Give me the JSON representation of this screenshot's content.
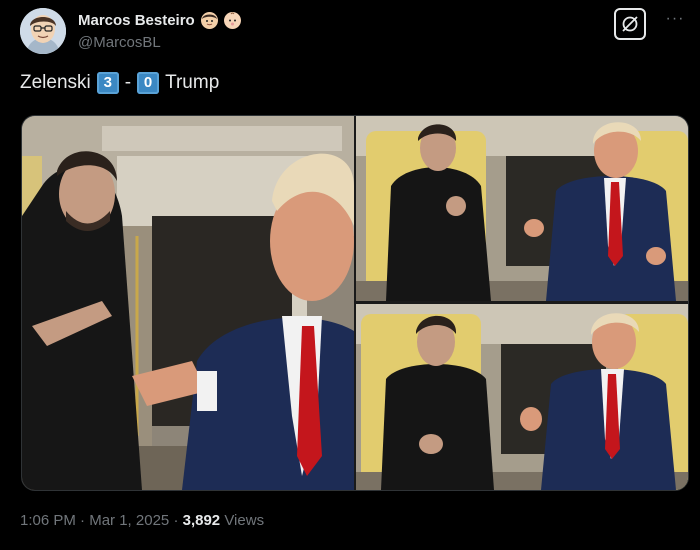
{
  "author": {
    "display_name": "Marcos Besteiro",
    "handle": "@MarcosBL",
    "avatar_icon": "cartoon-avatar-icon",
    "badges": [
      "face-emoji-icon",
      "baby-face-emoji-icon"
    ]
  },
  "actions": {
    "grok_icon": "grok-icon",
    "more_icon": "more-options-icon",
    "more_label": "···"
  },
  "tweet": {
    "text_left": "Zelenski",
    "score_left": "3",
    "separator": "-",
    "score_right": "0",
    "text_right": "Trump"
  },
  "media": {
    "count": 3,
    "photos": [
      "photo-main",
      "photo-top-right",
      "photo-bottom-right"
    ]
  },
  "meta": {
    "time": "1:06 PM",
    "dot1": "·",
    "date": "Mar 1, 2025",
    "dot2": "·",
    "views_count": "3,892",
    "views_label": "Views"
  },
  "colors": {
    "background": "#000000",
    "text": "#e7e9ea",
    "secondary": "#71767b",
    "keycap": "#3b88c3",
    "tie": "#c4161c",
    "suit": "#1d2c55"
  }
}
